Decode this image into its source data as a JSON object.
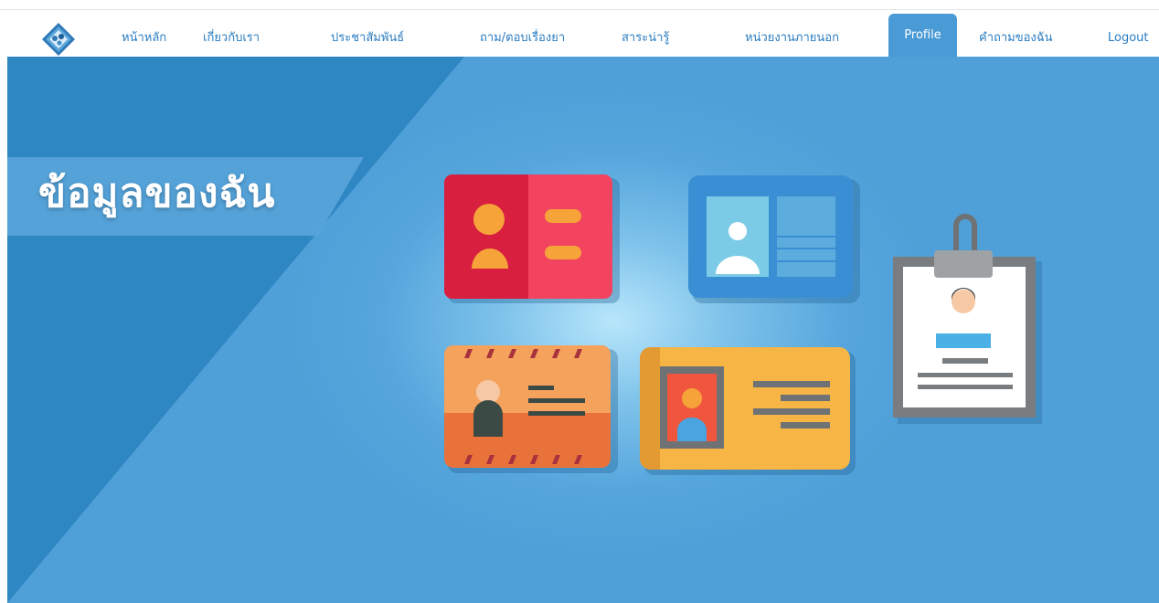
{
  "nav": {
    "items": [
      {
        "label": "หน้าหลัก",
        "active": false
      },
      {
        "label": "เกี่ยวกับเรา",
        "active": false
      },
      {
        "label": "ประชาสัมพันธ์",
        "active": false
      },
      {
        "label": "ถาม/ตอบเรื่องยา",
        "active": false
      },
      {
        "label": "สาระน่ารู้",
        "active": false
      },
      {
        "label": "หน่วยงานภายนอก",
        "active": false
      },
      {
        "label": "Profile",
        "active": true
      },
      {
        "label": "คำถามของฉัน",
        "active": false
      },
      {
        "label": "Logout",
        "active": false
      }
    ]
  },
  "hero": {
    "title": "ข้อมูลของฉัน",
    "illustration": [
      "id-card-red-icon",
      "id-card-blue-icon",
      "id-card-orange-icon",
      "id-card-yellow-icon",
      "badge-clipboard-icon"
    ]
  },
  "colors": {
    "nav_text": "#2a7cc0",
    "active_tab": "#4a9ad6",
    "hero_bg": "#4f9fd8",
    "hero_dark": "#2e86c2"
  }
}
